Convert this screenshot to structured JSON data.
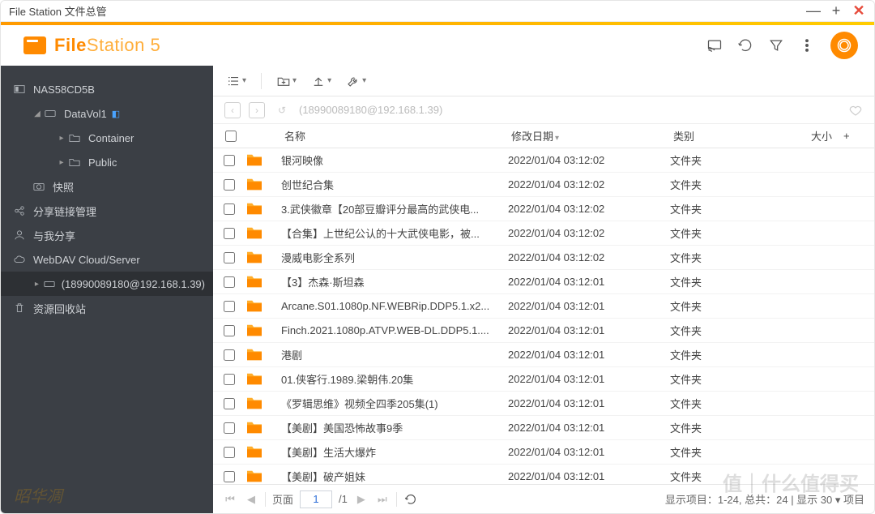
{
  "window": {
    "title": "File Station 文件总管"
  },
  "app": {
    "logo_a": "File",
    "logo_b": "Station 5"
  },
  "sidebar": {
    "root": "NAS58CD5B",
    "vol": "DataVol1",
    "folders": [
      "Container",
      "Public"
    ],
    "snap": "快照",
    "share": "分享链接管理",
    "withme": "与我分享",
    "webdav": "WebDAV Cloud/Server",
    "conn": "(18990089180@192.168.1.39)",
    "recycle": "资源回收站"
  },
  "pathbar": {
    "text": "(18990089180@192.168.1.39)"
  },
  "columns": {
    "name": "名称",
    "mtime": "修改日期",
    "type": "类别",
    "size": "大小"
  },
  "rows": [
    {
      "name": "银河映像",
      "mtime": "2022/01/04 03:12:02",
      "type": "文件夹"
    },
    {
      "name": "创世纪合集",
      "mtime": "2022/01/04 03:12:02",
      "type": "文件夹"
    },
    {
      "name": "3.武侠徽章【20部豆瓣评分最高的武侠电...",
      "mtime": "2022/01/04 03:12:02",
      "type": "文件夹"
    },
    {
      "name": "【合集】上世纪公认的十大武侠电影，被...",
      "mtime": "2022/01/04 03:12:02",
      "type": "文件夹"
    },
    {
      "name": "漫威电影全系列",
      "mtime": "2022/01/04 03:12:02",
      "type": "文件夹"
    },
    {
      "name": "【3】杰森·斯坦森",
      "mtime": "2022/01/04 03:12:01",
      "type": "文件夹"
    },
    {
      "name": "Arcane.S01.1080p.NF.WEBRip.DDP5.1.x2...",
      "mtime": "2022/01/04 03:12:01",
      "type": "文件夹"
    },
    {
      "name": "Finch.2021.1080p.ATVP.WEB-DL.DDP5.1....",
      "mtime": "2022/01/04 03:12:01",
      "type": "文件夹"
    },
    {
      "name": "港剧",
      "mtime": "2022/01/04 03:12:01",
      "type": "文件夹"
    },
    {
      "name": "01.侠客行.1989.梁朝伟.20集",
      "mtime": "2022/01/04 03:12:01",
      "type": "文件夹"
    },
    {
      "name": "《罗辑思维》视频全四季205集(1)",
      "mtime": "2022/01/04 03:12:01",
      "type": "文件夹"
    },
    {
      "name": "【美剧】美国恐怖故事9季",
      "mtime": "2022/01/04 03:12:01",
      "type": "文件夹"
    },
    {
      "name": "【美剧】生活大爆炸",
      "mtime": "2022/01/04 03:12:01",
      "type": "文件夹"
    },
    {
      "name": "【美剧】破产姐妹",
      "mtime": "2022/01/04 03:12:01",
      "type": "文件夹"
    }
  ],
  "pager": {
    "page_label": "页面",
    "page": "1",
    "pages": "/1",
    "summary": "显示项目：1-24, 总共：24  |  显示  30  ▾ 项目"
  },
  "watermark": "昭华凋",
  "watermark2": "值｜什么值得买"
}
